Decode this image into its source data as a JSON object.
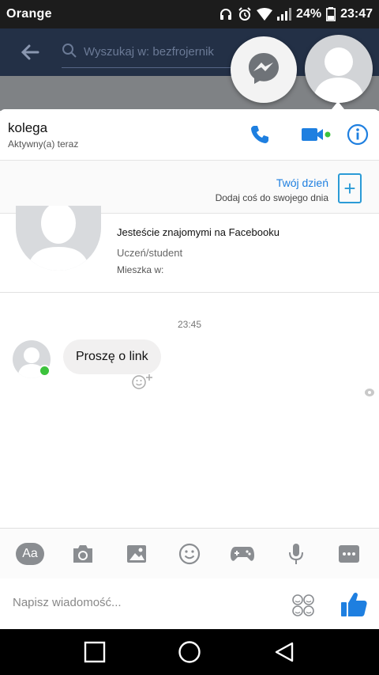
{
  "status_bar": {
    "carrier": "Orange",
    "battery": "24%",
    "time": "23:47"
  },
  "app_header": {
    "search_placeholder": "Wyszukaj w: bezfrojernik"
  },
  "chat": {
    "contact_name": "kolega",
    "contact_status": "Aktywny(a) teraz"
  },
  "story": {
    "title": "Twój dzień",
    "subtitle": "Dodaj coś do swojego dnia"
  },
  "profile": {
    "friends_text": "Jesteście znajomymi na Facebooku",
    "occupation": "Uczeń/student",
    "lives_in": "Mieszka w:"
  },
  "messages": {
    "timestamp": "23:45",
    "items": [
      {
        "sender": "kolega",
        "text": "Proszę o link"
      }
    ]
  },
  "composer": {
    "placeholder": "Napisz wiadomość...",
    "text_tool_label": "Aa"
  },
  "colors": {
    "accent": "#1e7fe0",
    "online": "#3cc23c",
    "header_dim": "#233046"
  }
}
